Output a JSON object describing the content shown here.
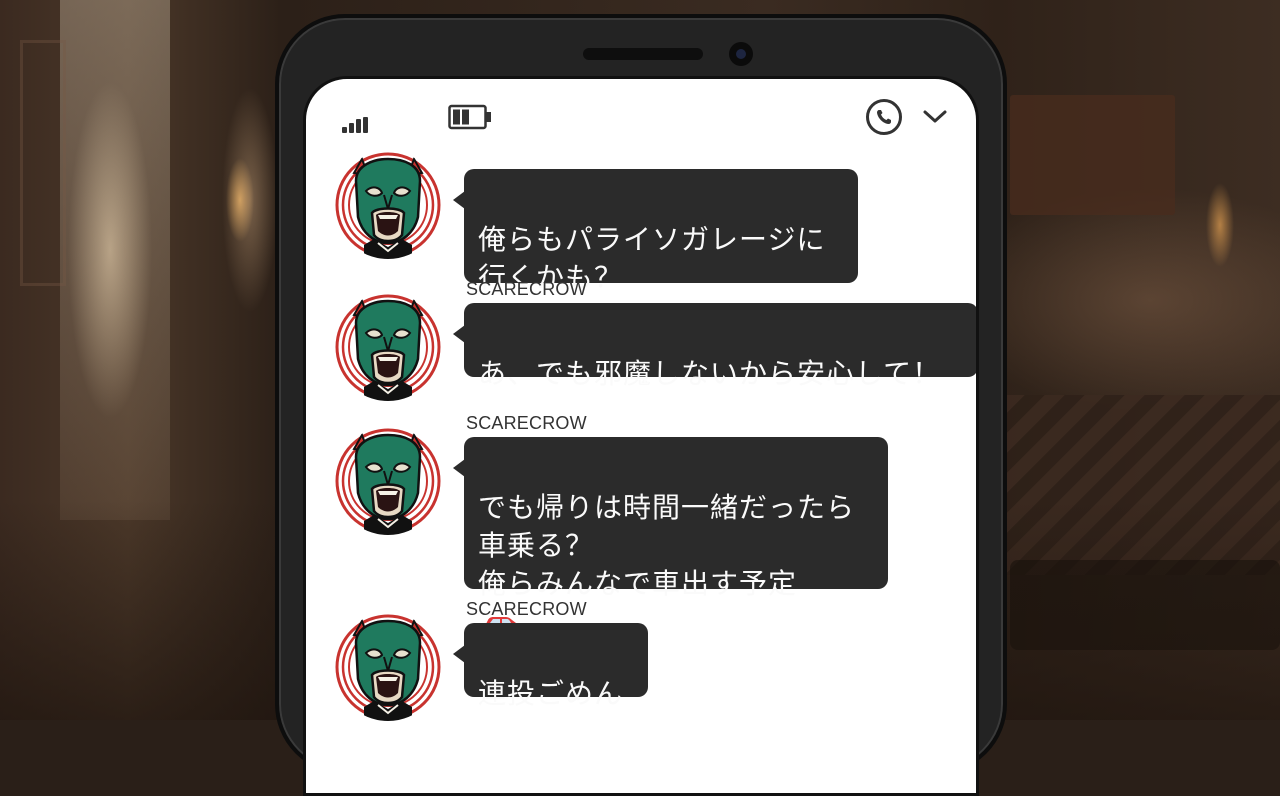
{
  "chat": {
    "messages": [
      {
        "sender": "",
        "text": "俺らもパライソガレージに\n行くかも？",
        "avatar_icon": "scarecrow-mask-avatar"
      },
      {
        "sender": "SCARECROW",
        "text": "あ、でも邪魔しないから安心して！",
        "avatar_icon": "scarecrow-mask-avatar"
      },
      {
        "sender": "SCARECROW",
        "text": "でも帰りは時間一緒だったら\n車乗る？\n俺らみんなで車出す予定",
        "emoji": "red-car-icon",
        "avatar_icon": "scarecrow-mask-avatar"
      },
      {
        "sender": "SCARECROW",
        "text": "連投ごめん",
        "avatar_icon": "scarecrow-mask-avatar"
      }
    ]
  },
  "status_bar": {
    "signal_icon": "signal-bars-icon",
    "battery_icon": "battery-icon",
    "call_icon": "phone-call-icon",
    "collapse_icon": "chevron-down-icon"
  },
  "colors": {
    "bubble": "#2b2b2b",
    "bubble_text": "#fafafa",
    "mask_green": "#1f7a5e",
    "ring_red": "#c8332f",
    "car_red": "#e03a3a"
  }
}
